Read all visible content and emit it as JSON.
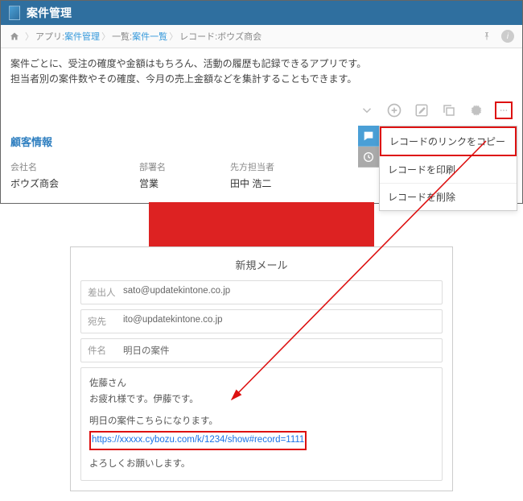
{
  "header": {
    "title": "案件管理"
  },
  "breadcrumb": {
    "app_prefix": "アプリ: ",
    "app_name": "案件管理",
    "list_prefix": "一覧: ",
    "list_name": "案件一覧",
    "record_prefix": "レコード: ",
    "record_name": "ボウズ商会"
  },
  "description": {
    "line1": "案件ごとに、受注の確度や金額はもちろん、活動の履歴も記録できるアプリです。",
    "line2": "担当者別の案件数やその確度、今月の売上金額などを集計することもできます。"
  },
  "dropdown": {
    "copy_link": "レコードのリンクをコピー",
    "print": "レコードを印刷",
    "delete": "レコードを削除"
  },
  "customer_info": {
    "title": "顧客情報",
    "company_label": "会社名",
    "company_value": "ボウズ商会",
    "dept_label": "部署名",
    "dept_value": "営業",
    "contact_label": "先方担当者",
    "contact_value": "田中 浩二"
  },
  "mail": {
    "title": "新規メール",
    "from_label": "差出人",
    "from_value": "sato@updatekintone.co.jp",
    "to_label": "宛先",
    "to_value": "ito@updatekintone.co.jp",
    "subject_label": "件名",
    "subject_value": "明日の案件",
    "body_greeting": "佐藤さん",
    "body_line1": "お疲れ様です。伊藤です。",
    "body_line2": "明日の案件こちらになります。",
    "body_link": "https://xxxxx.cybozu.com/k/1234/show#record=1111",
    "body_closing": "よろしくお願いします。"
  }
}
